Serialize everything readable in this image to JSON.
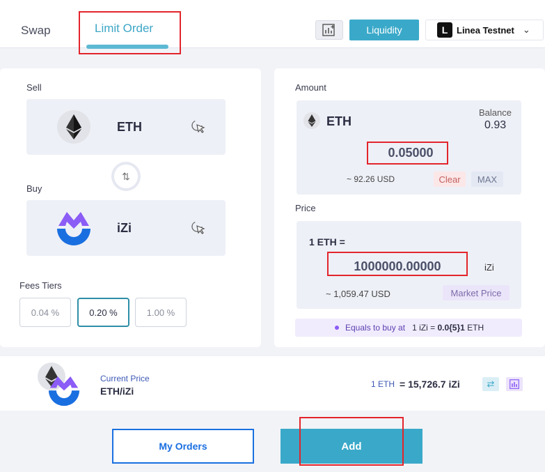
{
  "header": {
    "tab_swap": "Swap",
    "tab_limit": "Limit Order",
    "liquidity_label": "Liquidity",
    "network_name": "Linea Testnet",
    "network_logo_letter": "L"
  },
  "left": {
    "sell_label": "Sell",
    "sell_token": "ETH",
    "buy_label": "Buy",
    "buy_token": "iZi",
    "fees_label": "Fees Tiers",
    "fees": [
      "0.04 %",
      "0.20 %",
      "1.00 %"
    ],
    "selected_fee_index": 1
  },
  "right": {
    "amount_label": "Amount",
    "token": "ETH",
    "balance_label": "Balance",
    "balance_value": "0.93",
    "amount_value": "0.05000",
    "amount_usd": "~ 92.26 USD",
    "clear_label": "Clear",
    "max_label": "MAX",
    "price_label": "Price",
    "price_prefix": "1 ETH =",
    "price_value": "1000000.00000",
    "price_unit": "iZi",
    "price_usd": "~ 1,059.47 USD",
    "market_price_label": "Market Price",
    "equals_text": "Equals to buy at",
    "equals_unit": "1 iZi =",
    "equals_value": "0.0{5}1",
    "equals_token": "ETH"
  },
  "current": {
    "label": "Current Price",
    "pair": "ETH/iZi",
    "lhs": "1 ETH",
    "rhs": "= 15,726.7 iZi"
  },
  "actions": {
    "my_orders": "My Orders",
    "add": "Add"
  },
  "colors": {
    "accent": "#3aa9c9",
    "highlight": "#e3242b",
    "izi": "#1a6fe0"
  }
}
